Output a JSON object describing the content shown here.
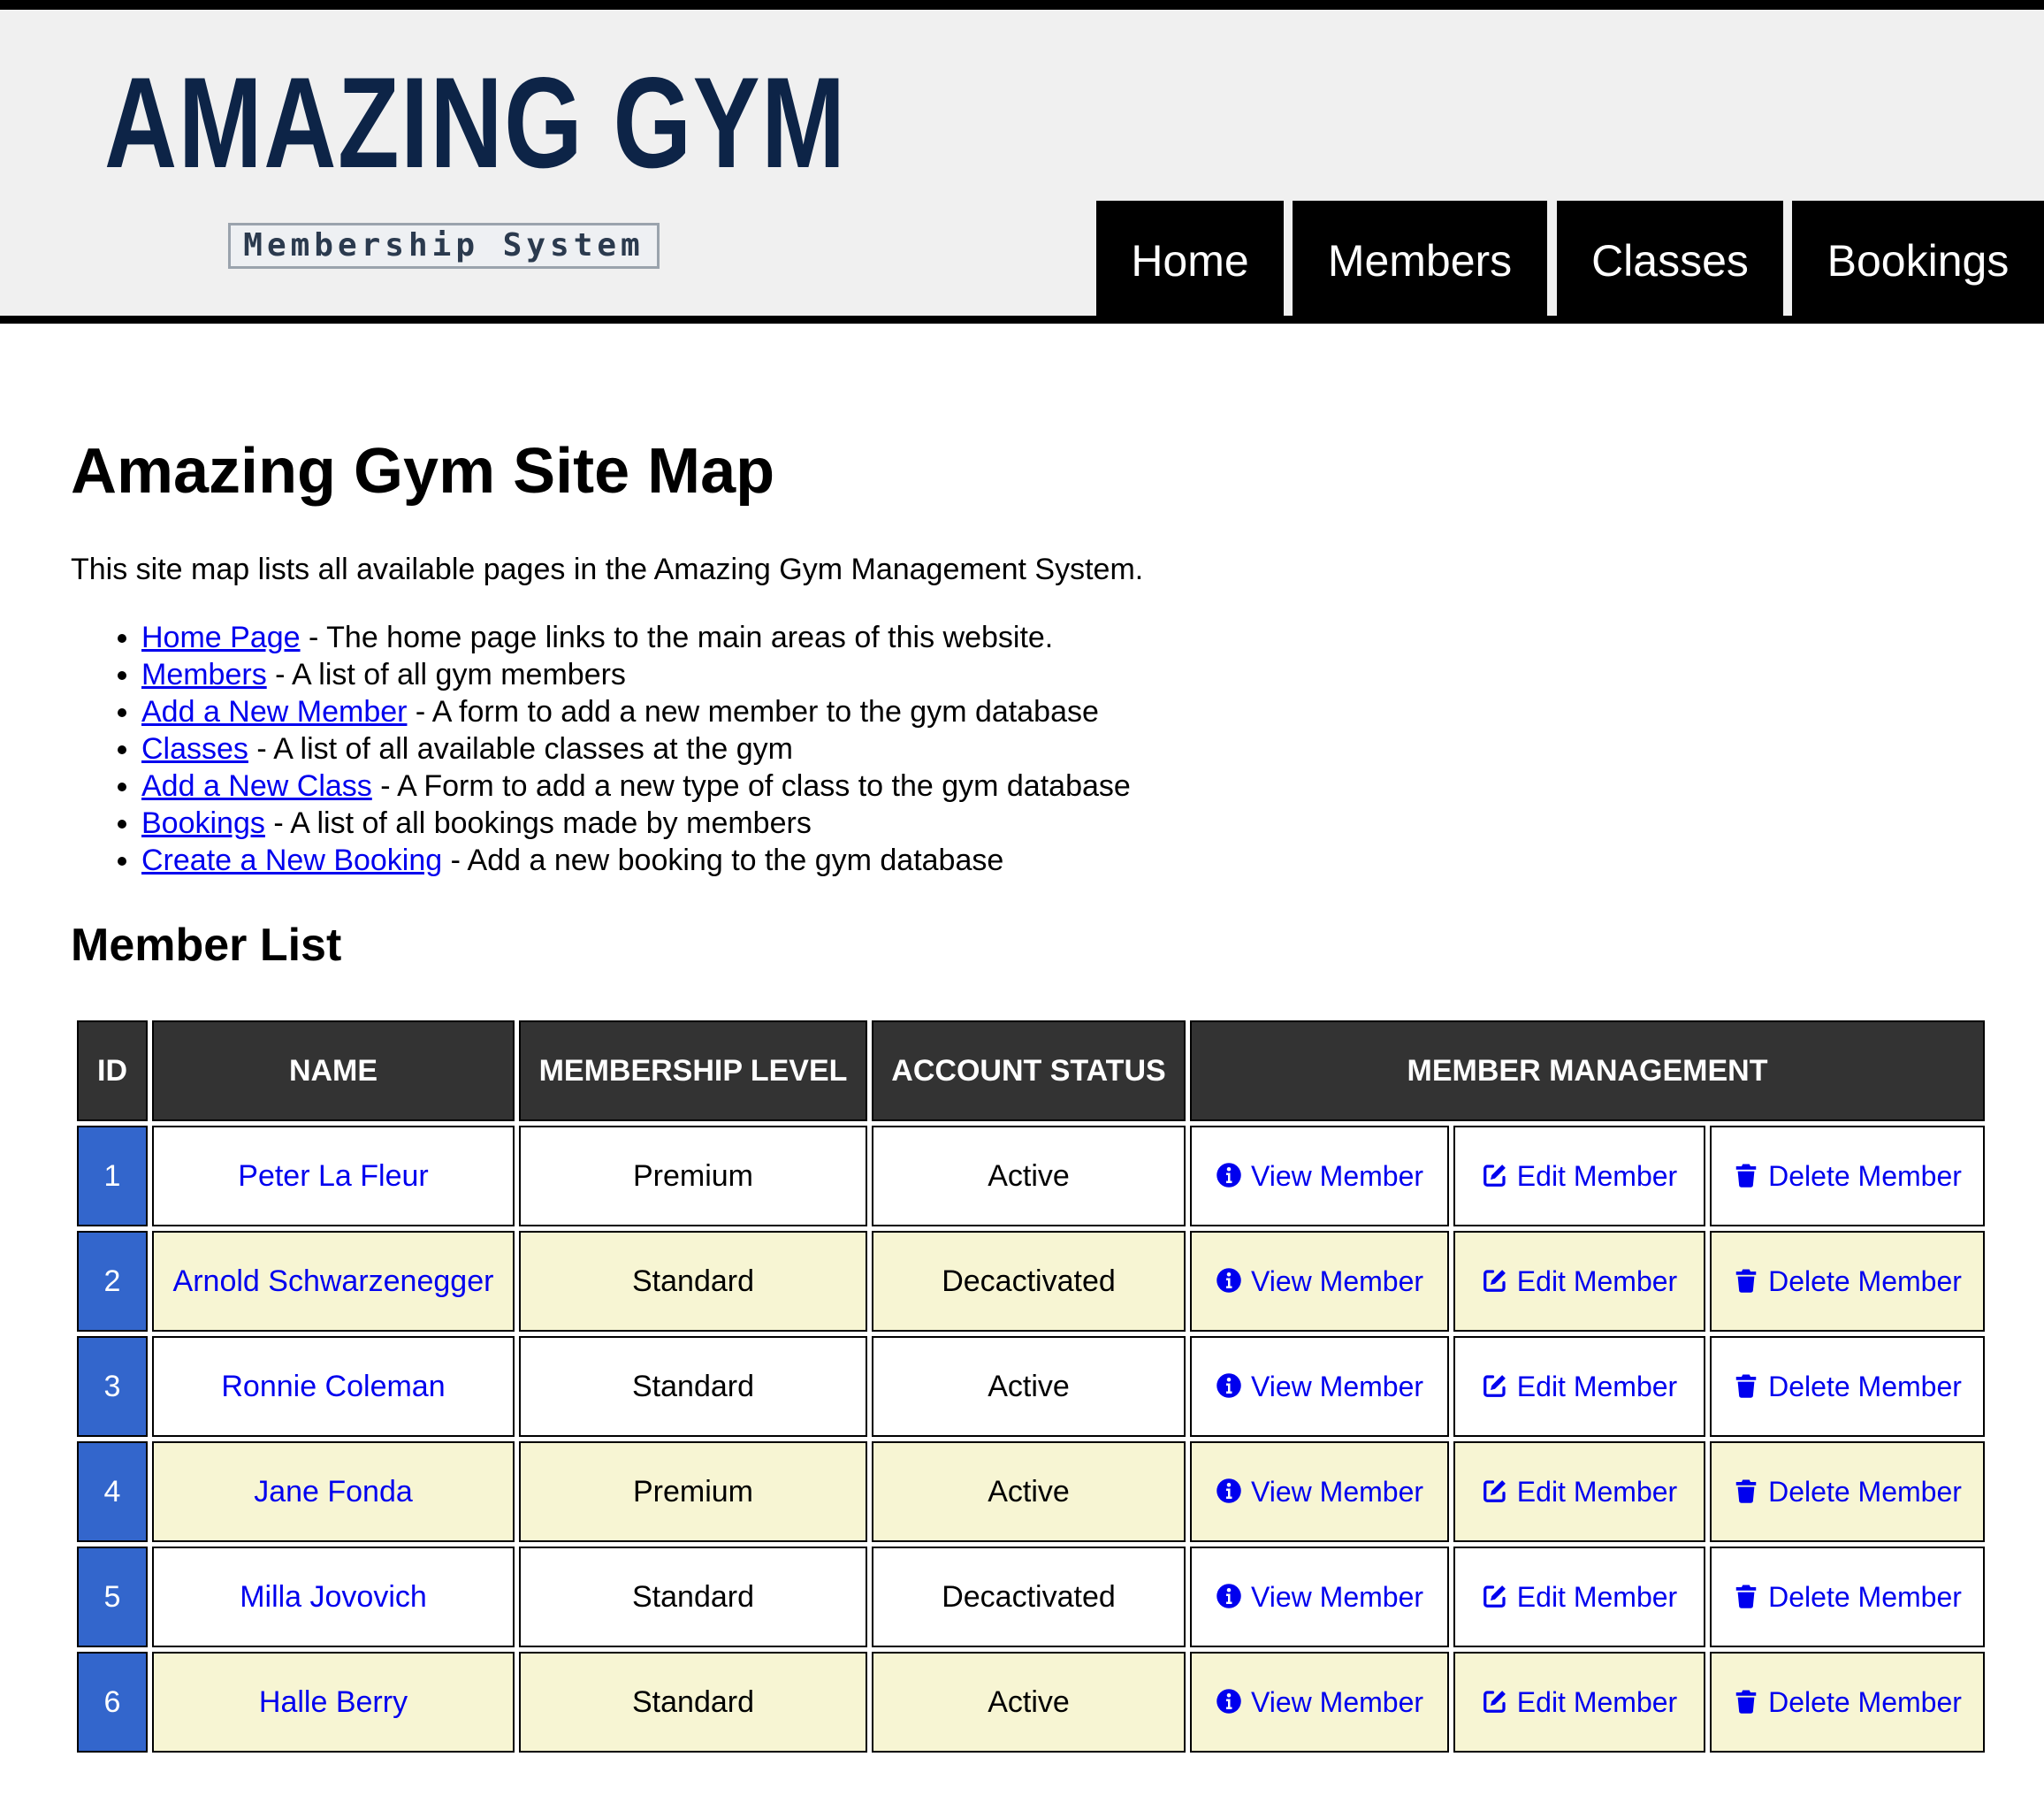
{
  "header": {
    "logo_title": "AMAZING GYM",
    "logo_subtitle": "Membership System",
    "logo_color": "#0d2447",
    "nav": [
      {
        "label": "Home"
      },
      {
        "label": "Members"
      },
      {
        "label": "Classes"
      },
      {
        "label": "Bookings"
      }
    ]
  },
  "main": {
    "title": "Amazing Gym Site Map",
    "intro": "This site map lists all available pages in the Amazing Gym Management System.",
    "sitemap": [
      {
        "link": "Home Page",
        "desc": " - The home page links to the main areas of this website."
      },
      {
        "link": "Members",
        "desc": " - A list of all gym members"
      },
      {
        "link": "Add a New Member",
        "desc": " - A form to add a new member to the gym database"
      },
      {
        "link": "Classes",
        "desc": " - A list of all available classes at the gym"
      },
      {
        "link": "Add a New Class",
        "desc": " - A Form to add a new type of class to the gym database"
      },
      {
        "link": "Bookings",
        "desc": " - A list of all bookings made by members"
      },
      {
        "link": "Create a New Booking",
        "desc": " - Add a new booking to the gym database"
      }
    ],
    "member_list_title": "Member List"
  },
  "table": {
    "headers": {
      "id": "ID",
      "name": "NAME",
      "membership_level": "MEMBERSHIP LEVEL",
      "account_status": "ACCOUNT STATUS",
      "management": "MEMBER MANAGEMENT"
    },
    "actions": {
      "view": "View Member",
      "edit": "Edit Member",
      "delete": "Delete Member"
    },
    "icons": {
      "view": "info-circle-icon",
      "edit": "edit-square-icon",
      "delete": "trash-icon"
    },
    "colors": {
      "header_bg": "#333333",
      "id_bg": "#3366cc",
      "alt_row_bg": "#f7f5d3",
      "link": "#0000ee"
    },
    "rows": [
      {
        "id": "1",
        "name": "Peter La Fleur",
        "level": "Premium",
        "status": "Active"
      },
      {
        "id": "2",
        "name": "Arnold Schwarzenegger",
        "level": "Standard",
        "status": "Decactivated"
      },
      {
        "id": "3",
        "name": "Ronnie Coleman",
        "level": "Standard",
        "status": "Active"
      },
      {
        "id": "4",
        "name": "Jane Fonda",
        "level": "Premium",
        "status": "Active"
      },
      {
        "id": "5",
        "name": "Milla Jovovich",
        "level": "Standard",
        "status": "Decactivated"
      },
      {
        "id": "6",
        "name": "Halle Berry",
        "level": "Standard",
        "status": "Active"
      }
    ]
  }
}
